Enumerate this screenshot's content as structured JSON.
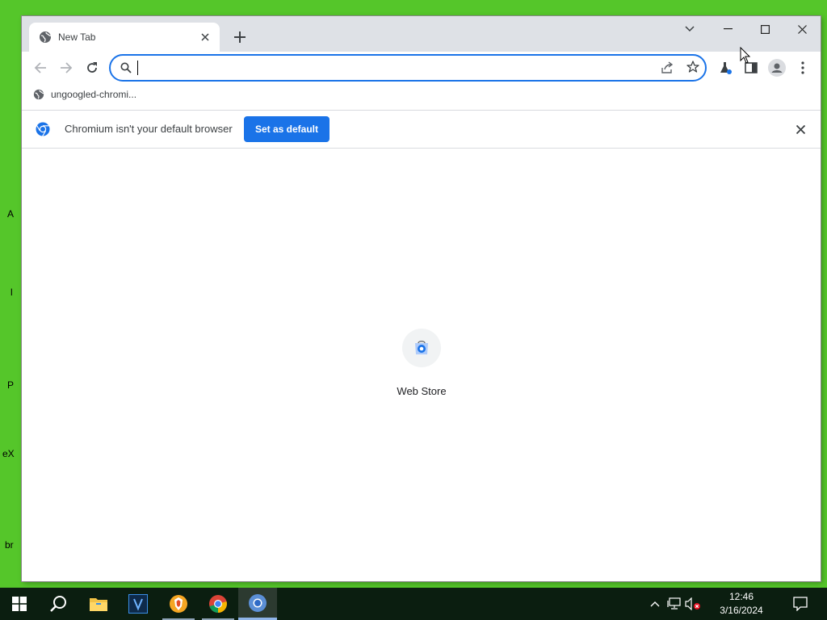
{
  "desktop": {
    "fragments": [
      "A",
      "l",
      "P",
      "eX",
      "br"
    ]
  },
  "browser": {
    "tab": {
      "title": "New Tab",
      "favicon": "globe-icon",
      "close_icon": "close-icon"
    },
    "new_tab_icon": "plus-icon",
    "window_controls": [
      "tab-search-icon",
      "minimize-icon",
      "maximize-icon",
      "close-icon"
    ],
    "omnibox": {
      "value": "",
      "placeholder": "",
      "search_icon": "search-icon"
    },
    "nav_icons": [
      "back-icon",
      "forward-icon",
      "reload-icon"
    ],
    "toolbar_icons": [
      "share-icon",
      "star-icon",
      "labs-flask-icon",
      "side-panel-icon",
      "profile-icon",
      "menu-kebab-icon"
    ],
    "bookmarks": [
      {
        "label": "ungoogled-chromi...",
        "icon": "globe-icon"
      }
    ],
    "infobar": {
      "message": "Chromium isn't your default browser",
      "button": "Set as default",
      "icon": "chromium-logo-icon",
      "close_icon": "close-icon"
    },
    "shortcuts": [
      {
        "label": "Web Store",
        "icon": "web-store-icon"
      }
    ]
  },
  "taskbar": {
    "apps": [
      "start-icon",
      "search-icon",
      "file-explorer-icon",
      "app-v-icon",
      "brave-icon",
      "chrome-icon",
      "chromium-icon"
    ],
    "tray": [
      "chevron-up-icon",
      "network-icon",
      "volume-muted-icon",
      "notification-icon"
    ],
    "clock": {
      "time": "12:46",
      "date": "3/16/2024"
    }
  },
  "colors": {
    "accent": "#1a73e8",
    "desktop": "#55c62a",
    "taskbar": "#0b1e10"
  }
}
